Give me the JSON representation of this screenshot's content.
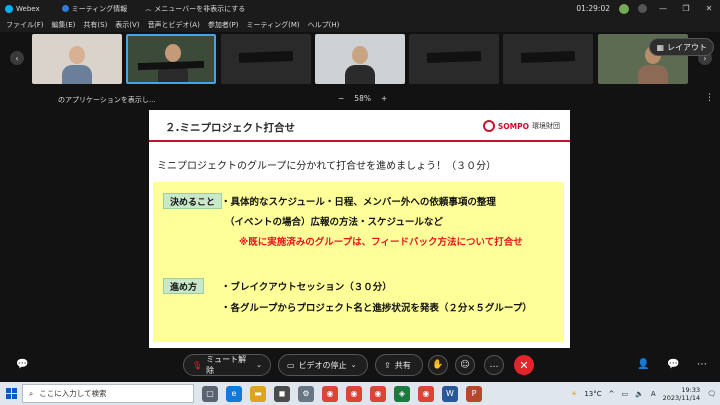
{
  "titlebar": {
    "app_name": "Webex",
    "meeting_info": "ミーティング情報",
    "hide_menu": "メニューバーを非表示にする",
    "timer": "01:29:02"
  },
  "menu": [
    "ファイル(F)",
    "編集(E)",
    "共有(S)",
    "表示(V)",
    "音声とビデオ(A)",
    "参加者(P)",
    "ミーティング(M)",
    "ヘルプ(H)"
  ],
  "participants": {
    "layout_label": "レイアウト"
  },
  "sharebar": {
    "app_label": "のアプリケーションを表示し...",
    "zoom_minus": "−",
    "zoom_value": "58%",
    "zoom_plus": "+"
  },
  "slide": {
    "title": "２.ミニプロジェクト打合せ",
    "logo_text": "SOMPO",
    "logo_jp": "環境財団",
    "intro": "ミニプロジェクトのグループに分かれて打合せを進めましょう！（３０分）",
    "tag1": "決めること",
    "tag1_lines": [
      "・具体的なスケジュール・日程、メンバー外への依頼事項の整理",
      "（イベントの場合）広報の方法・スケジュールなど",
      "※既に実施済みのグループは、フィードバック方法について打合せ"
    ],
    "tag2": "進め方",
    "tag2_lines": [
      "・ブレイクアウトセッション（３０分）",
      "・各グループからプロジェクト名と進捗状況を発表（２分×５グループ）"
    ]
  },
  "controls": {
    "unmute_label": "ミュート解除",
    "stop_video_label": "ビデオの停止",
    "share_label": "共有"
  },
  "taskbar": {
    "search_placeholder": "ここに入力して検索",
    "weather": "13°C",
    "time": "19:33",
    "date": "2023/11/14"
  },
  "colors": {
    "accent_red": "#c8102e",
    "end_call": "#e0262b",
    "slide_yellow": "#ffff99",
    "tag_green": "#c9e7c9"
  }
}
